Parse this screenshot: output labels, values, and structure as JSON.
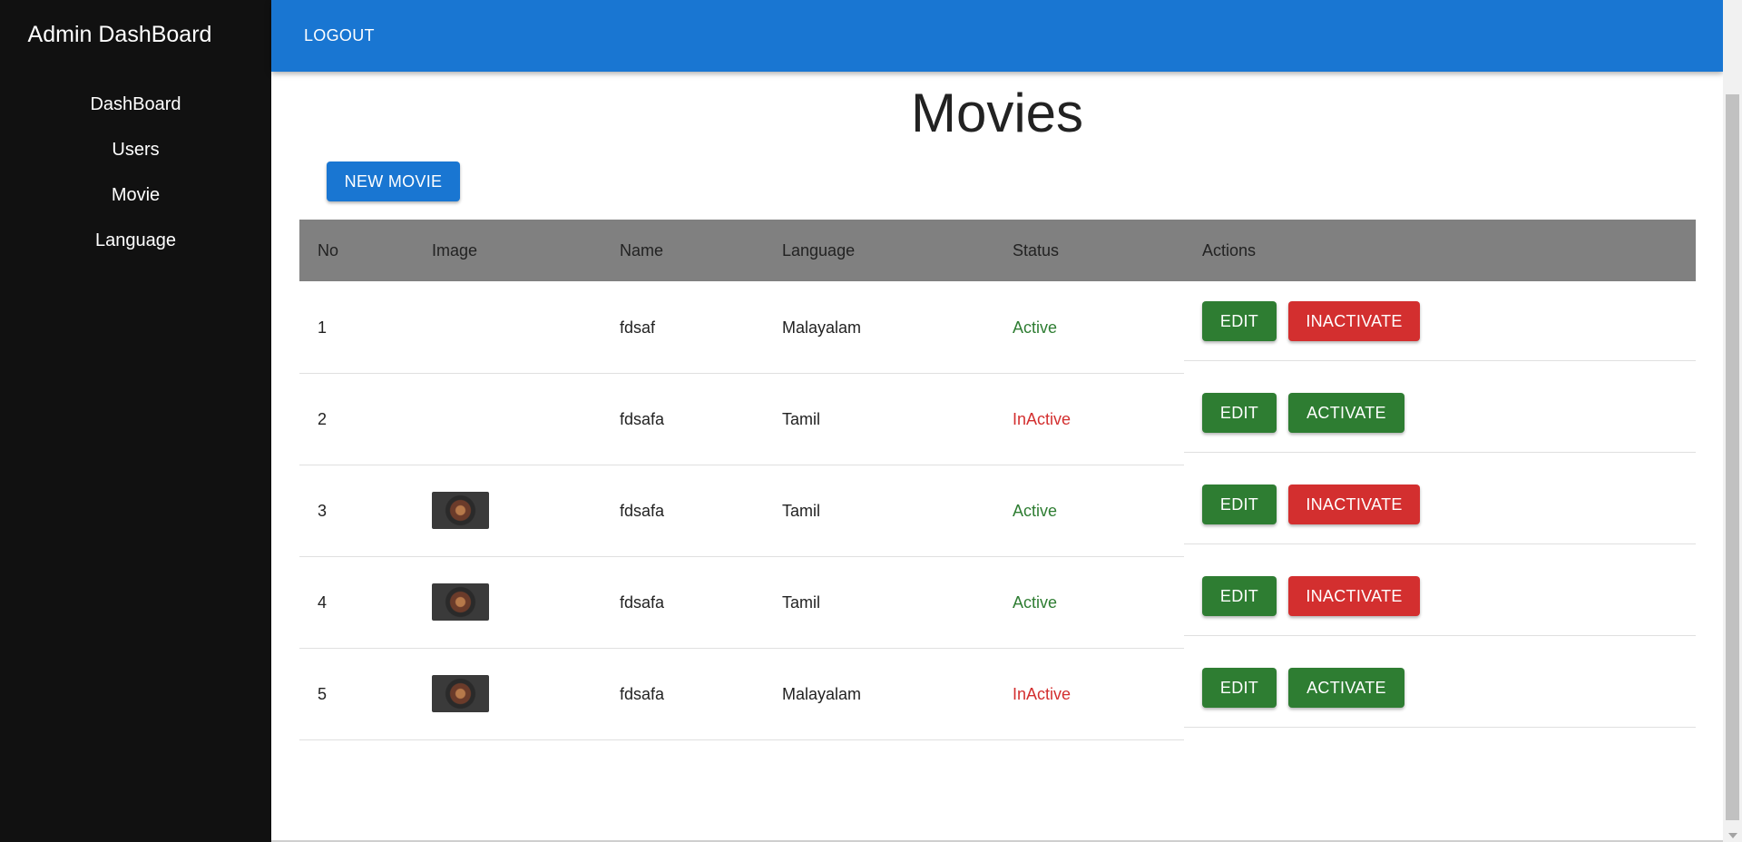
{
  "sidebar": {
    "title": "Admin DashBoard",
    "items": [
      {
        "label": "DashBoard"
      },
      {
        "label": "Users"
      },
      {
        "label": "Movie"
      },
      {
        "label": "Language"
      }
    ]
  },
  "appbar": {
    "logout_label": "LOGOUT"
  },
  "page": {
    "title": "Movies",
    "new_button": "NEW MOVIE"
  },
  "table": {
    "headers": {
      "no": "No",
      "image": "Image",
      "name": "Name",
      "language": "Language",
      "status": "Status",
      "actions": "Actions"
    },
    "rows": [
      {
        "no": "1",
        "has_image": false,
        "name": "fdsaf",
        "language": "Malayalam",
        "status": "Active",
        "edit": "EDIT",
        "toggle": "INACTIVATE"
      },
      {
        "no": "2",
        "has_image": false,
        "name": "fdsafa",
        "language": "Tamil",
        "status": "InActive",
        "edit": "EDIT",
        "toggle": "ACTIVATE"
      },
      {
        "no": "3",
        "has_image": true,
        "name": "fdsafa",
        "language": "Tamil",
        "status": "Active",
        "edit": "EDIT",
        "toggle": "INACTIVATE"
      },
      {
        "no": "4",
        "has_image": true,
        "name": "fdsafa",
        "language": "Tamil",
        "status": "Active",
        "edit": "EDIT",
        "toggle": "INACTIVATE"
      },
      {
        "no": "5",
        "has_image": true,
        "name": "fdsafa",
        "language": "Malayalam",
        "status": "InActive",
        "edit": "EDIT",
        "toggle": "ACTIVATE"
      }
    ]
  },
  "colors": {
    "sidebar": "#111111",
    "appbar": "#1976d2",
    "edit": "#2e7d32",
    "inactivate": "#d32f2f",
    "activate": "#2e7d32",
    "active_text": "#2e7d32",
    "inactive_text": "#d32f2f"
  }
}
